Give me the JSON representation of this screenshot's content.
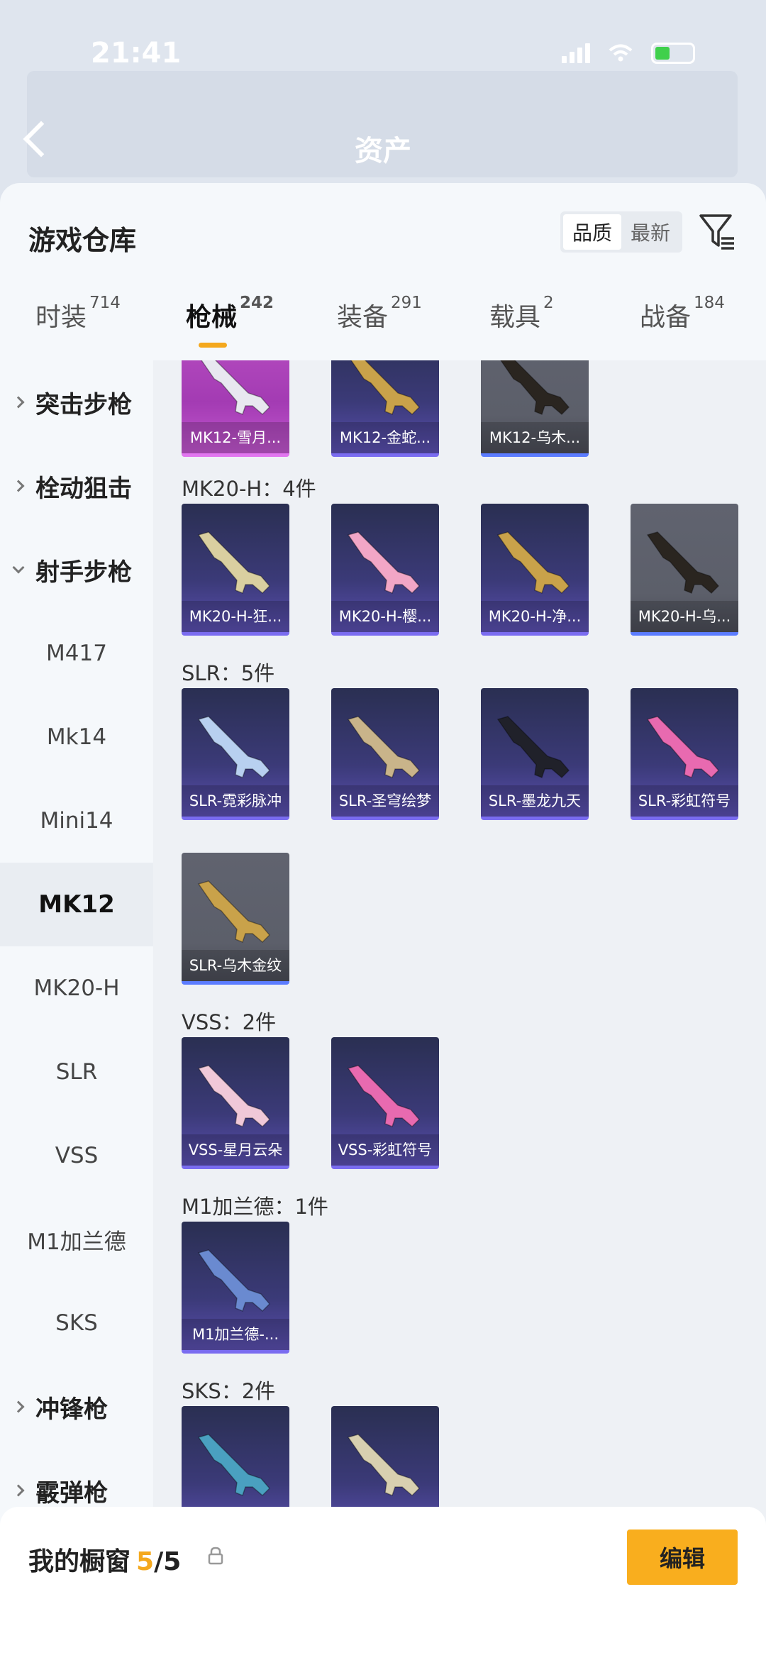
{
  "status_bar": {
    "time": "21:41"
  },
  "header": {
    "title": "资产"
  },
  "sheet": {
    "title": "游戏仓库",
    "sort": {
      "options": [
        "品质",
        "最新"
      ],
      "active": "品质"
    }
  },
  "tabs": [
    {
      "label": "时装",
      "count": "714"
    },
    {
      "label": "枪械",
      "count": "242"
    },
    {
      "label": "装备",
      "count": "291"
    },
    {
      "label": "载具",
      "count": "2"
    },
    {
      "label": "战备",
      "count": "184"
    }
  ],
  "sidebar": {
    "items": [
      {
        "label": "突击步枪",
        "type": "category",
        "expanded": false
      },
      {
        "label": "栓动狙击",
        "type": "category",
        "expanded": false
      },
      {
        "label": "射手步枪",
        "type": "category",
        "expanded": true
      },
      {
        "label": "M417",
        "type": "sub"
      },
      {
        "label": "Mk14",
        "type": "sub"
      },
      {
        "label": "Mini14",
        "type": "sub"
      },
      {
        "label": "MK12",
        "type": "sub",
        "active": true
      },
      {
        "label": "MK20-H",
        "type": "sub"
      },
      {
        "label": "SLR",
        "type": "sub"
      },
      {
        "label": "VSS",
        "type": "sub"
      },
      {
        "label": "M1加兰德",
        "type": "sub"
      },
      {
        "label": "SKS",
        "type": "sub"
      },
      {
        "label": "冲锋枪",
        "type": "category",
        "expanded": false
      },
      {
        "label": "霰弹枪",
        "type": "category",
        "expanded": false
      }
    ]
  },
  "groups": [
    {
      "label": "",
      "items": [
        {
          "name": "MK12-雪月...",
          "rarity": "pink",
          "gun_color": "#e8e8f0"
        },
        {
          "name": "MK12-金蛇...",
          "rarity": "purple",
          "gun_color": "#c9a24a"
        },
        {
          "name": "MK12-乌木...",
          "rarity": "grey",
          "gun_color": "#2a2520"
        }
      ]
    },
    {
      "label": "MK20-H：4件",
      "items": [
        {
          "name": "MK20-H-狂...",
          "rarity": "purple",
          "gun_color": "#d9cfa0"
        },
        {
          "name": "MK20-H-樱...",
          "rarity": "purple",
          "gun_color": "#f2a6c6"
        },
        {
          "name": "MK20-H-净...",
          "rarity": "purple",
          "gun_color": "#c9a24a"
        },
        {
          "name": "MK20-H-乌...",
          "rarity": "grey",
          "gun_color": "#2a2520"
        }
      ]
    },
    {
      "label": "SLR：5件",
      "items": [
        {
          "name": "SLR-霓彩脉冲",
          "rarity": "purple",
          "gun_color": "#b8d0f0"
        },
        {
          "name": "SLR-圣穹绘梦",
          "rarity": "purple",
          "gun_color": "#c9b48a"
        },
        {
          "name": "SLR-墨龙九天",
          "rarity": "purple",
          "gun_color": "#20212a"
        },
        {
          "name": "SLR-彩虹符号",
          "rarity": "purple",
          "gun_color": "#e86ab0"
        },
        {
          "name": "SLR-乌木金纹",
          "rarity": "grey",
          "gun_color": "#c9a24a"
        }
      ]
    },
    {
      "label": "VSS：2件",
      "items": [
        {
          "name": "VSS-星月云朵",
          "rarity": "purple",
          "gun_color": "#f0c8d8"
        },
        {
          "name": "VSS-彩虹符号",
          "rarity": "purple",
          "gun_color": "#e86ab0"
        }
      ]
    },
    {
      "label": "M1加兰德：1件",
      "items": [
        {
          "name": "M1加兰德-...",
          "rarity": "purple",
          "gun_color": "#6a8ad0"
        }
      ]
    },
    {
      "label": "SKS：2件",
      "items": [
        {
          "name": "",
          "rarity": "purple",
          "gun_color": "#4aa0c0"
        },
        {
          "name": "",
          "rarity": "purple",
          "gun_color": "#d8d0b0"
        }
      ]
    }
  ],
  "showcase": {
    "title": "我的橱窗",
    "count": "5",
    "total": "/5",
    "edit_label": "编辑"
  },
  "colors": {
    "accent": "#f9ae1e",
    "purple_card": "#3b3a78",
    "pink_card": "#b94fc2",
    "grey_card": "#5c5f6a"
  }
}
